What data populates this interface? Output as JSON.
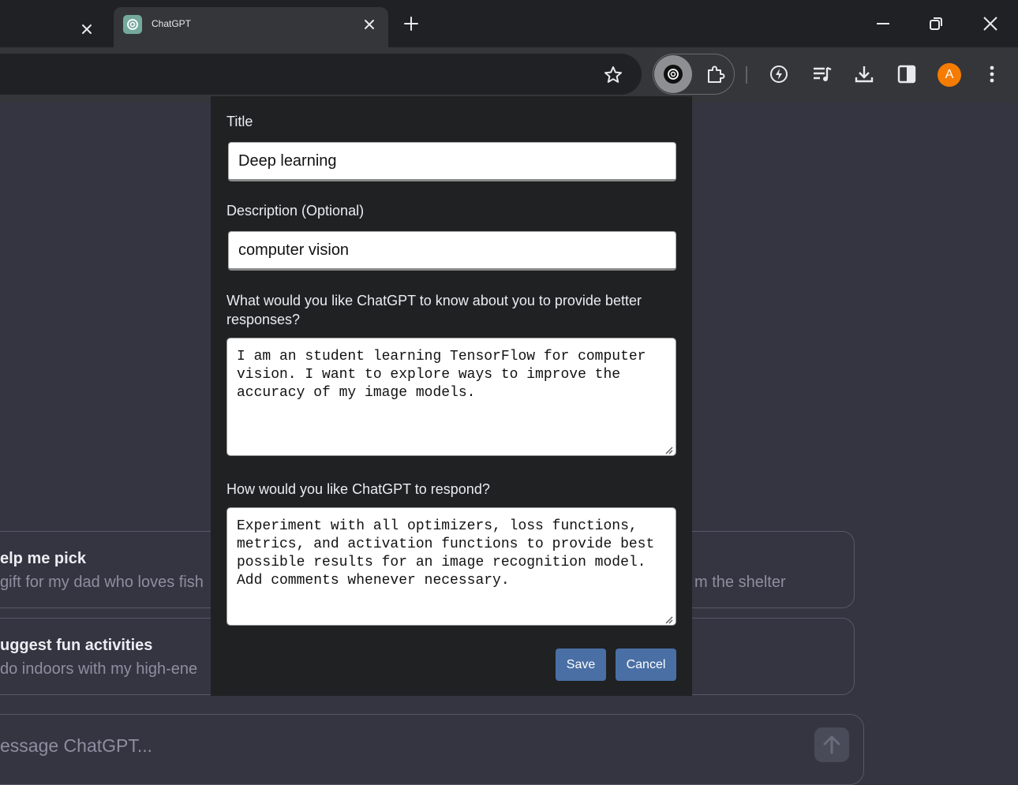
{
  "browser": {
    "active_tab_title": "ChatGPT",
    "profile_initial": "A"
  },
  "background": {
    "cards": [
      {
        "title": "elp me pick",
        "subtitle": "gift for my dad who loves fish"
      },
      {
        "title": "",
        "subtitle": "m the shelter"
      },
      {
        "title": "uggest fun activities",
        "subtitle": "do indoors with my high-ene"
      }
    ],
    "message_placeholder": "essage ChatGPT..."
  },
  "popup": {
    "title_label": "Title",
    "title_value": "Deep learning",
    "description_label": "Description (Optional)",
    "description_value": "computer vision",
    "about_label": "What would you like ChatGPT to know about you to provide better responses?",
    "about_value": "I am an student learning TensorFlow for computer vision. I want to explore ways to improve the accuracy of my image models.",
    "respond_label": "How would you like ChatGPT to respond?",
    "respond_value": "Experiment with all optimizers, loss functions, metrics, and activation functions to provide best possible results for an image recognition model. Add comments whenever necessary.",
    "save_label": "Save",
    "cancel_label": "Cancel"
  },
  "colors": {
    "page_bg": "#343541",
    "popup_bg": "#202123",
    "button_bg": "#4a6fa5",
    "avatar_bg": "#f57c00"
  },
  "icons": [
    "close-icon",
    "chatgpt-icon",
    "plus-icon",
    "minimize-icon",
    "restore-icon",
    "star-icon",
    "puzzle-icon",
    "leaf-icon",
    "playlist-icon",
    "download-icon",
    "side-panel-icon",
    "more-vertical-icon",
    "arrow-up-icon"
  ]
}
